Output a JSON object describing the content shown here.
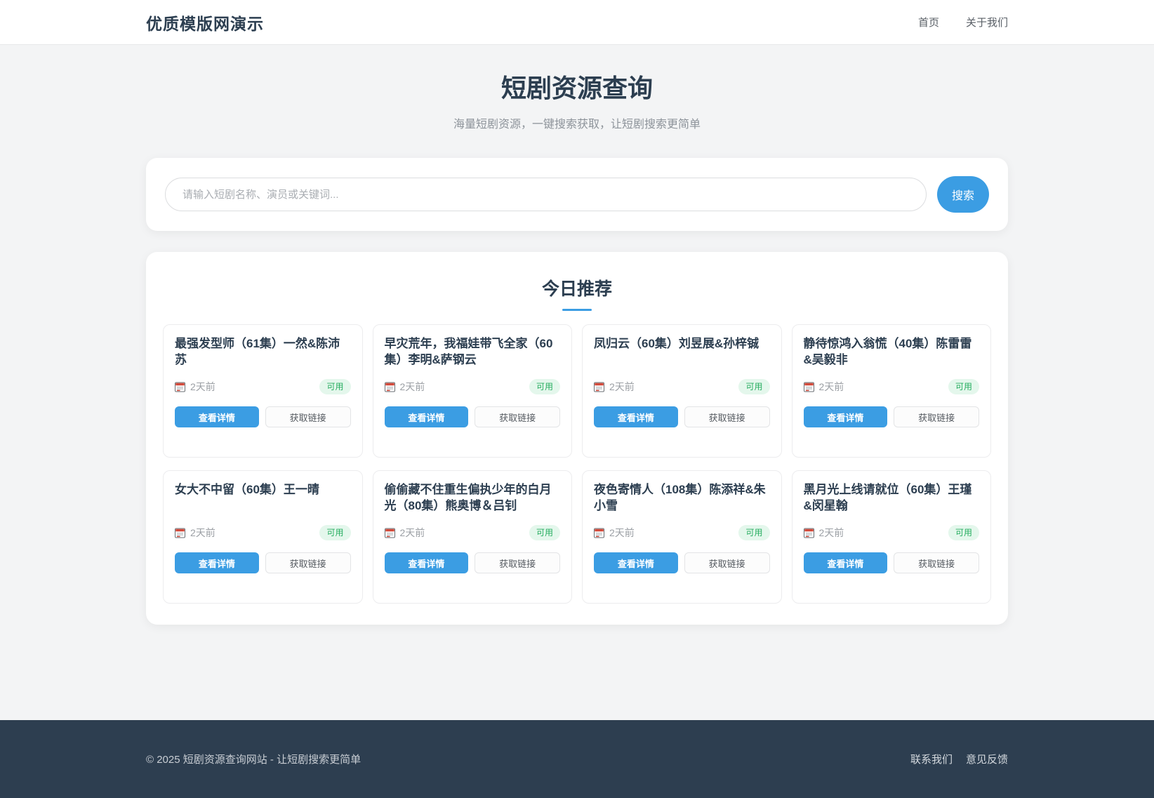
{
  "header": {
    "logo": "优质模版网演示",
    "nav": [
      {
        "label": "首页"
      },
      {
        "label": "关于我们"
      }
    ]
  },
  "hero": {
    "title": "短剧资源查询",
    "subtitle": "海量短剧资源，一键搜索获取，让短剧搜索更简单"
  },
  "search": {
    "placeholder": "请输入短剧名称、演员或关键词...",
    "value": "",
    "button_label": "搜索"
  },
  "recommend": {
    "section_title": "今日推荐",
    "detail_label": "查看详情",
    "link_label": "获取链接",
    "cards": [
      {
        "title": "最强发型师（61集）一然&陈沛苏",
        "time": "2天前",
        "status": "可用"
      },
      {
        "title": "早灾荒年，我福娃带飞全家（60集）李明&萨钢云",
        "time": "2天前",
        "status": "可用"
      },
      {
        "title": "凤归云（60集）刘昱展&孙梓铖",
        "time": "2天前",
        "status": "可用"
      },
      {
        "title": "静待惊鸿入翁慌（40集）陈雷雷&吴毅非",
        "time": "2天前",
        "status": "可用"
      },
      {
        "title": "女大不中留（60集）王一晴",
        "time": "2天前",
        "status": "可用"
      },
      {
        "title": "偷偷藏不住重生偏执少年的白月光（80集）熊奥博＆吕钊",
        "time": "2天前",
        "status": "可用"
      },
      {
        "title": "夜色寄情人（108集）陈添祥&朱小雪",
        "time": "2天前",
        "status": "可用"
      },
      {
        "title": "黑月光上线请就位（60集）王瑾&闵星翰",
        "time": "2天前",
        "status": "可用"
      }
    ]
  },
  "footer": {
    "copyright": "© 2025 短剧资源查询网站 - 让短剧搜索更简单",
    "links": [
      {
        "label": "联系我们"
      },
      {
        "label": "意见反馈"
      }
    ]
  },
  "colors": {
    "accent": "#3b9de3",
    "title_text": "#2c3e50",
    "badge_text": "#27ae60",
    "badge_bg": "#e4f7ec",
    "footer_bg": "#2d3e50",
    "page_bg": "#f3f4f5"
  }
}
